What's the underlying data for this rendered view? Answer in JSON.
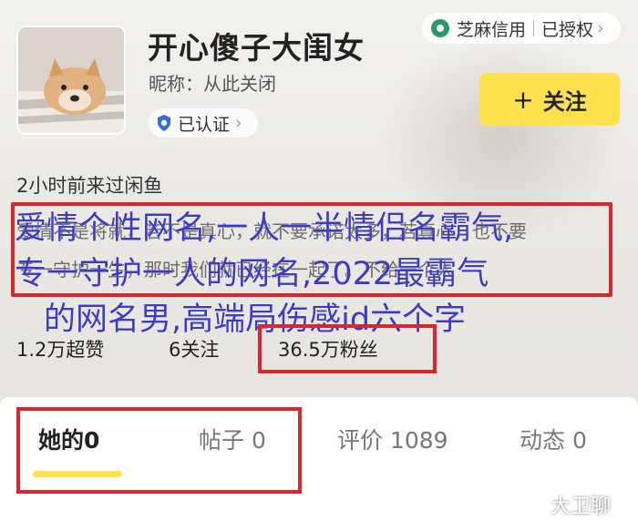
{
  "header": {
    "badge": {
      "sesame_label": "芝麻信用",
      "auth_label": "已授权"
    },
    "title": "开心傻子大闺女",
    "nickname": "昵称：从此关闭",
    "verified_label": "已认证",
    "follow_label": "关注"
  },
  "profile": {
    "last_seen": "2小时前来过闲鱼",
    "bio_line1": "爱情不是将就，若不是真心，就不要承诺太多，若真心，也不要",
    "bio_line2": "专一守护一生，那时我们就已经在一起了。不给一个人",
    "overlay_line1": "爱情个性网名,一人一半情侣名霸气,",
    "overlay_line2": "专一守护一人的网名,2022最霸气",
    "overlay_line3": "的网名男,高端局伤感id六个字"
  },
  "stats": {
    "likes": "1.2万超赞",
    "following": "6关注",
    "followers": "36.5万粉丝"
  },
  "tabs": [
    {
      "label": "她的0"
    },
    {
      "label": "帖子 0"
    },
    {
      "label": "评价 1089"
    },
    {
      "label": "动态 0"
    }
  ],
  "watermark": "大卫聊",
  "colors": {
    "accent_yellow": "#ffe14d",
    "highlight_red": "#d8282f",
    "overlay_blue": "#3b3bc4"
  }
}
